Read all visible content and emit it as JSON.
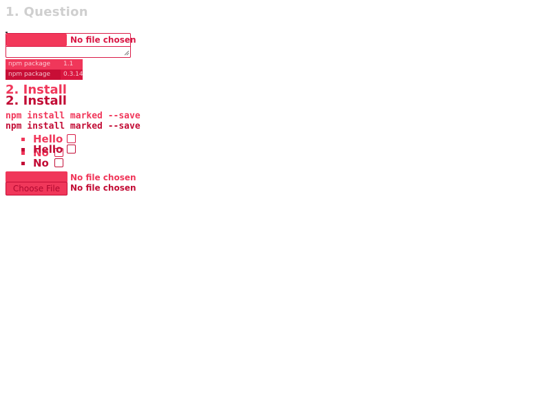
{
  "question": {
    "title": "1. Question"
  },
  "upload_1": {
    "status": "No file chosen"
  },
  "badges": [
    {
      "label": "npm package",
      "value": "1.1"
    },
    {
      "label": "npm package",
      "value": "0.3.14"
    }
  ],
  "install": {
    "heading": "2. Install",
    "heading_copy": "2. Install",
    "command": "npm install marked --save",
    "command_copy": "npm install marked --save"
  },
  "list": {
    "items": [
      {
        "label": "Hello"
      },
      {
        "label": "Hello"
      },
      {
        "label": "No"
      },
      {
        "label": "No"
      }
    ]
  },
  "upload_2": {
    "status": "No file chosen"
  },
  "upload_3": {
    "button_label": "Choose File",
    "status": "No file chosen"
  },
  "colors": {
    "accent": "#f0375a",
    "accent_dark": "#c20c35",
    "muted_heading": "#cfcfcf"
  }
}
